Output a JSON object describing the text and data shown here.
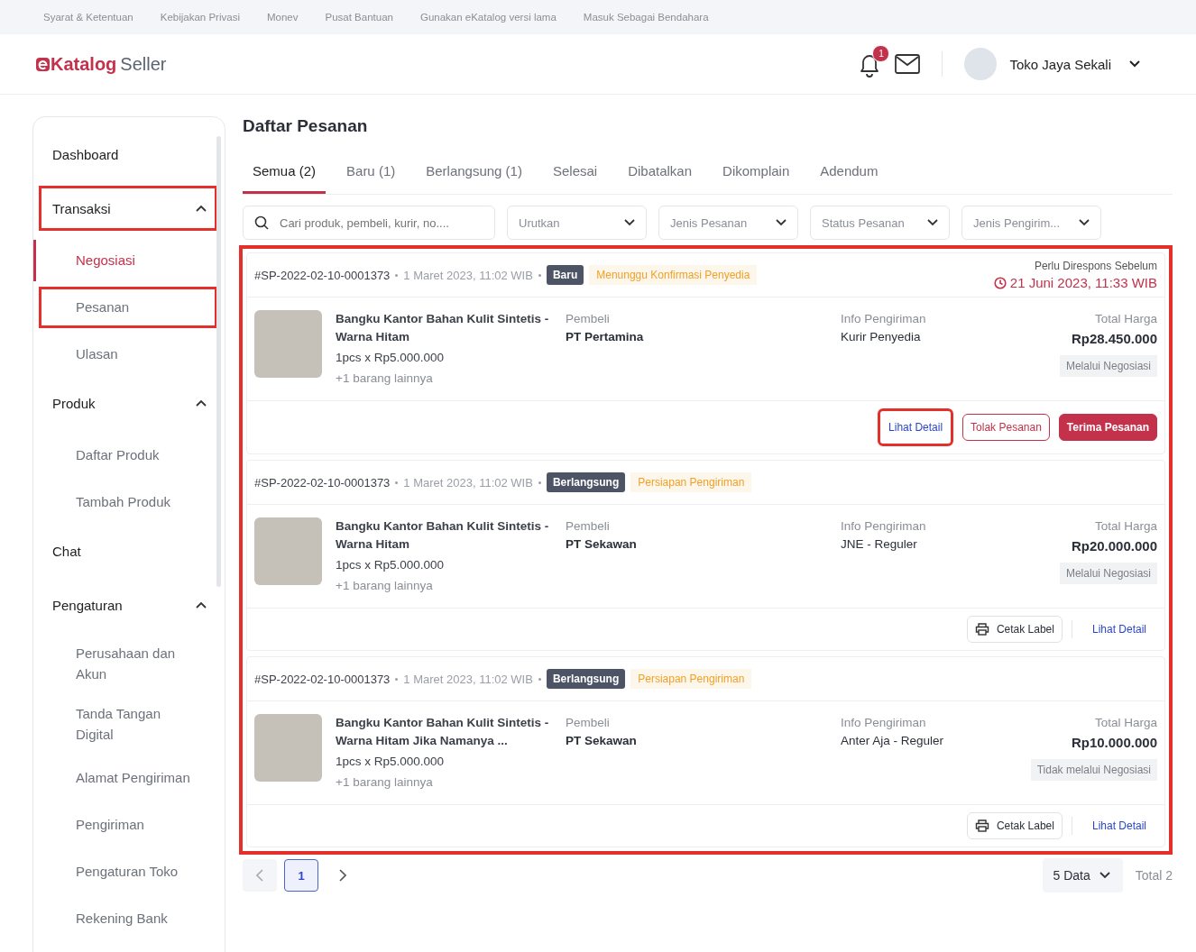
{
  "top_links": [
    "Syarat & Ketentuan",
    "Kebijakan Privasi",
    "Monev",
    "Pusat Bantuan",
    "Gunakan eKatalog versi lama",
    "Masuk Sebagai Bendahara"
  ],
  "header": {
    "logo_brand": "Katalog",
    "logo_suffix": "Seller",
    "notification_count": "1",
    "user_name": "Toko Jaya Sekali"
  },
  "sidebar": {
    "items": [
      {
        "label": "Dashboard",
        "highlighted": false
      },
      {
        "label": "Transaksi",
        "highlighted": true,
        "expanded": true,
        "children": [
          {
            "label": "Negosiasi",
            "selected": true,
            "highlighted": false
          },
          {
            "label": "Pesanan",
            "selected": false,
            "highlighted": true
          },
          {
            "label": "Ulasan",
            "selected": false,
            "highlighted": false
          }
        ]
      },
      {
        "label": "Produk",
        "highlighted": false,
        "expanded": true,
        "children": [
          {
            "label": "Daftar Produk",
            "selected": false,
            "highlighted": false
          },
          {
            "label": "Tambah Produk",
            "selected": false,
            "highlighted": false
          }
        ]
      },
      {
        "label": "Chat",
        "highlighted": false
      },
      {
        "label": "Pengaturan",
        "highlighted": false,
        "expanded": true,
        "children": [
          {
            "label": "Perusahaan dan Akun",
            "selected": false,
            "highlighted": false
          },
          {
            "label": "Tanda Tangan Digital",
            "selected": false,
            "highlighted": false
          },
          {
            "label": "Alamat Pengiriman",
            "selected": false,
            "highlighted": false
          },
          {
            "label": "Pengiriman",
            "selected": false,
            "highlighted": false
          },
          {
            "label": "Pengaturan Toko",
            "selected": false,
            "highlighted": false
          },
          {
            "label": "Rekening Bank",
            "selected": false,
            "highlighted": false
          }
        ]
      }
    ]
  },
  "page_title": "Daftar Pesanan",
  "tabs": [
    {
      "label": "Semua (2)",
      "selected": true
    },
    {
      "label": "Baru (1)",
      "selected": false
    },
    {
      "label": "Berlangsung (1)",
      "selected": false
    },
    {
      "label": "Selesai",
      "selected": false
    },
    {
      "label": "Dibatalkan",
      "selected": false
    },
    {
      "label": "Dikomplain",
      "selected": false
    },
    {
      "label": "Adendum",
      "selected": false
    }
  ],
  "filters": {
    "search_placeholder": "Cari produk, pembeli, kurir, no....",
    "dropdowns": [
      "Urutkan",
      "Jenis Pesanan",
      "Status Pesanan",
      "Jenis Pengirim..."
    ]
  },
  "orders_highlighted": true,
  "orders": [
    {
      "id": "#SP-2022-02-10-0001373",
      "date": "1 Maret 2023, 11:02 WIB",
      "status": "Baru",
      "substatus": "Menunggu Konfirmasi Penyedia",
      "deadline_label": "Perlu Direspons Sebelum",
      "deadline": "21 Juni 2023, 11:33 WIB",
      "product": "Bangku Kantor Bahan Kulit Sintetis - Warna Hitam",
      "qty": "1pcs x Rp5.000.000",
      "more": "+1 barang lainnya",
      "buyer_label": "Pembeli",
      "buyer": "PT Pertamina",
      "shipping_label": "Info Pengiriman",
      "shipping": "Kurir Penyedia",
      "total_label": "Total Harga",
      "total": "Rp28.450.000",
      "nego": "Melalui Negosiasi",
      "actions": [
        {
          "kind": "link",
          "label": "Lihat Detail",
          "highlighted": true
        },
        {
          "kind": "outline",
          "label": "Tolak Pesanan",
          "highlighted": false
        },
        {
          "kind": "primary",
          "label": "Terima Pesanan",
          "highlighted": false
        }
      ]
    },
    {
      "id": "#SP-2022-02-10-0001373",
      "date": "1 Maret 2023, 11:02 WIB",
      "status": "Berlangsung",
      "substatus": "Persiapan Pengiriman",
      "product": "Bangku Kantor Bahan Kulit Sintetis - Warna Hitam",
      "qty": "1pcs x Rp5.000.000",
      "more": "+1 barang lainnya",
      "buyer_label": "Pembeli",
      "buyer": "PT Sekawan",
      "shipping_label": "Info Pengiriman",
      "shipping": "JNE - Reguler",
      "total_label": "Total Harga",
      "total": "Rp20.000.000",
      "nego": "Melalui Negosiasi",
      "actions": [
        {
          "kind": "print",
          "label": "Cetak Label",
          "highlighted": false
        },
        {
          "kind": "link",
          "label": "Lihat Detail",
          "highlighted": false
        }
      ]
    },
    {
      "id": "#SP-2022-02-10-0001373",
      "date": "1 Maret 2023, 11:02 WIB",
      "status": "Berlangsung",
      "substatus": "Persiapan Pengiriman",
      "product": "Bangku Kantor Bahan Kulit Sintetis - Warna Hitam Jika Namanya ...",
      "qty": "1pcs x Rp5.000.000",
      "more": "+1 barang lainnya",
      "buyer_label": "Pembeli",
      "buyer": "PT Sekawan",
      "shipping_label": "Info Pengiriman",
      "shipping": "Anter Aja - Reguler",
      "total_label": "Total Harga",
      "total": "Rp10.000.000",
      "nego": "Tidak melalui Negosiasi",
      "actions": [
        {
          "kind": "print",
          "label": "Cetak Label",
          "highlighted": false
        },
        {
          "kind": "link",
          "label": "Lihat Detail",
          "highlighted": false
        }
      ]
    }
  ],
  "pagination": {
    "pages": [
      {
        "label": "1",
        "selected": true
      }
    ],
    "page_size": "5 Data",
    "total": "Total 2"
  }
}
